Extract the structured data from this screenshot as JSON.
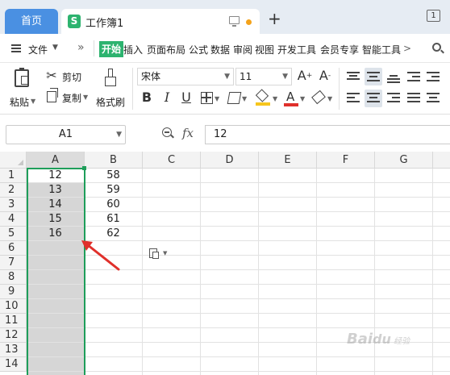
{
  "titlebar": {
    "home_tab": "首页",
    "doc_icon_letter": "S",
    "doc_title": "工作簿1",
    "new_tab": "+",
    "window_count": "1"
  },
  "menubar": {
    "file_label": "文件",
    "more": "»",
    "tabs": [
      "开始",
      "插入",
      "页面布局",
      "公式",
      "数据",
      "审阅",
      "视图",
      "开发工具",
      "会员专享",
      "智能工具"
    ],
    "overflow": ">",
    "search_icon": "search-icon"
  },
  "ribbon": {
    "paste_label": "粘贴",
    "cut_label": "剪切",
    "copy_label": "复制",
    "format_painter_label": "格式刷",
    "font_name": "宋体",
    "font_size": "11",
    "bold": "B",
    "italic": "I",
    "underline": "U",
    "font_color_letter": "A",
    "font_color": "#e0302b",
    "fill_color": "#f6c61d"
  },
  "formula_bar": {
    "name_box": "A1",
    "fx": "fx",
    "formula_value": "12"
  },
  "sheet": {
    "columns": [
      "A",
      "B",
      "C",
      "D",
      "E",
      "F",
      "G"
    ],
    "rows": [
      "1",
      "2",
      "3",
      "4",
      "5",
      "6",
      "7",
      "8",
      "9",
      "10",
      "11",
      "12",
      "13",
      "14"
    ],
    "col_a": [
      "12",
      "13",
      "14",
      "15",
      "16"
    ],
    "col_b": [
      "58",
      "59",
      "60",
      "61",
      "62"
    ],
    "selection_color": "#1e9e5a",
    "arrow_color": "#e0302b"
  }
}
